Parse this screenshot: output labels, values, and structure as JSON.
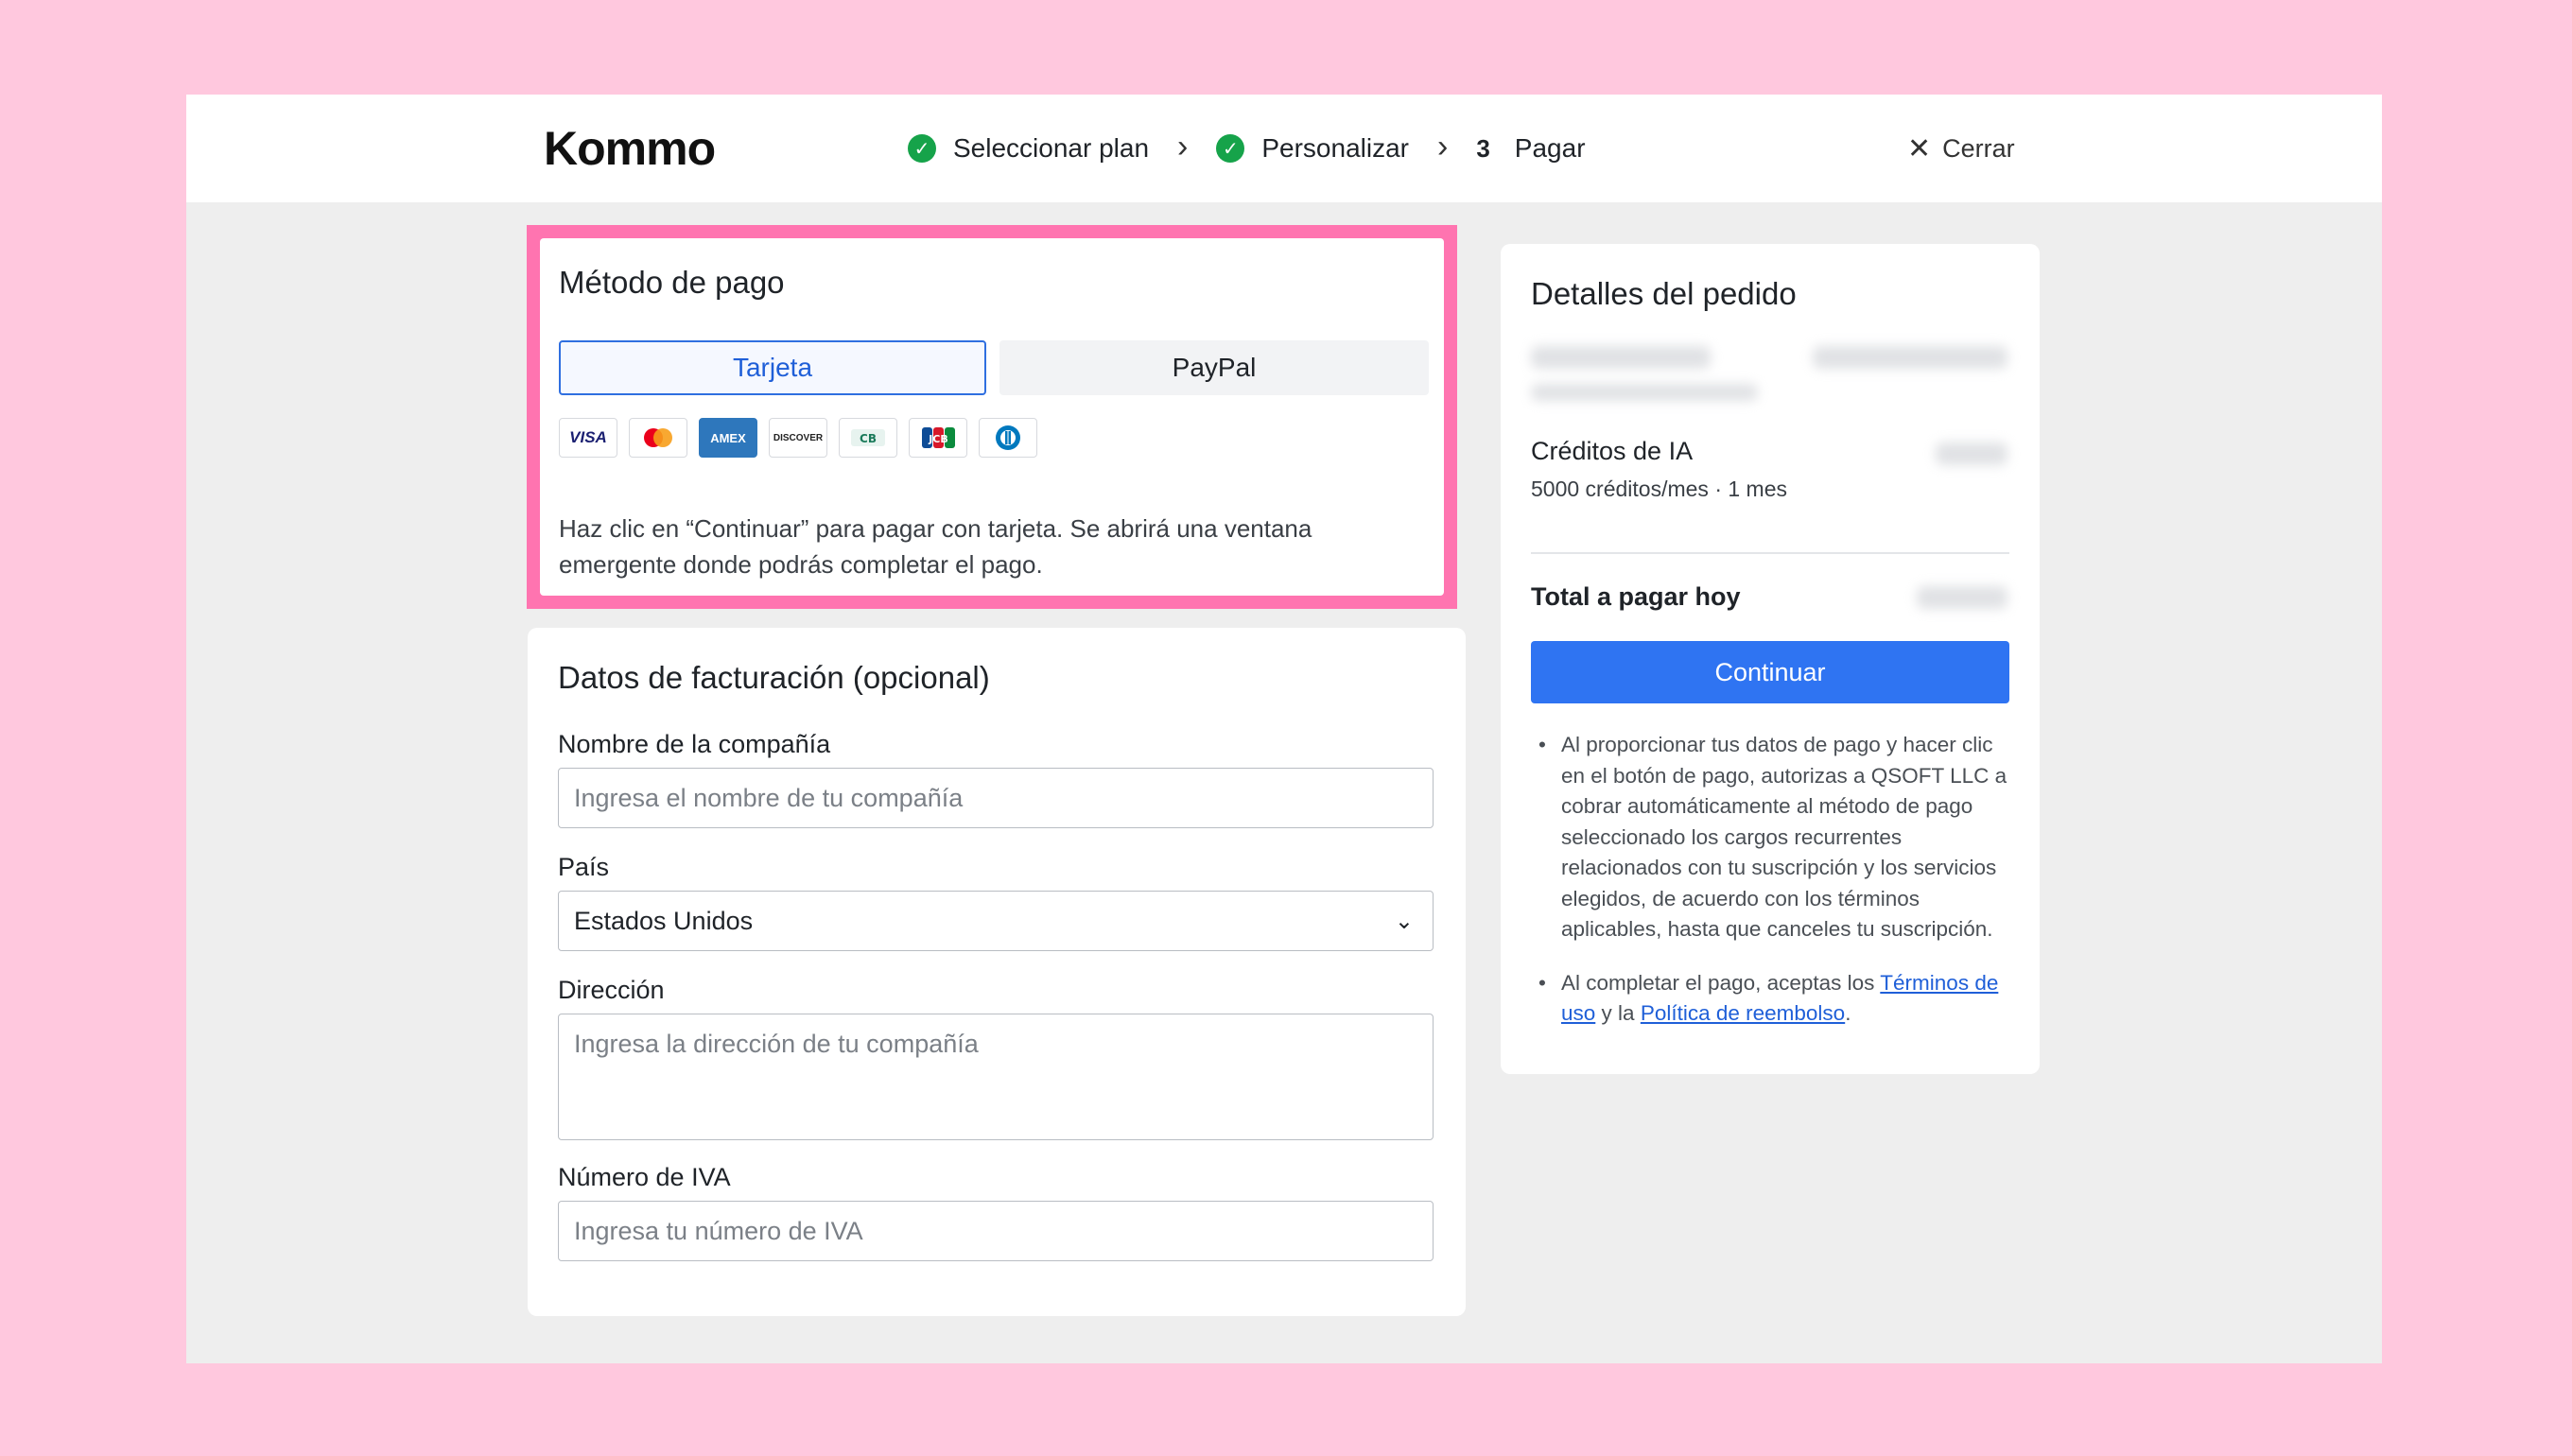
{
  "header": {
    "logo": "Kommo",
    "steps": [
      {
        "label": "Seleccionar plan",
        "status": "done"
      },
      {
        "label": "Personalizar",
        "status": "done"
      },
      {
        "label": "Pagar",
        "number": "3",
        "status": "current"
      }
    ],
    "close_label": "Cerrar"
  },
  "payment": {
    "title": "Método de pago",
    "tabs": [
      {
        "label": "Tarjeta",
        "selected": true
      },
      {
        "label": "PayPal",
        "selected": false
      }
    ],
    "card_brands": [
      "VISA",
      "mastercard",
      "AMEX",
      "DISCOVER",
      "CB",
      "JCB",
      "Diners Club"
    ],
    "description": "Haz clic en “Continuar” para pagar con tarjeta. Se abrirá una ventana emergente donde podrás completar el pago."
  },
  "billing": {
    "title": "Datos de facturación (opcional)",
    "company_label": "Nombre de la compañía",
    "company_placeholder": "Ingresa el nombre de tu compañía",
    "country_label": "País",
    "country_value": "Estados Unidos",
    "address_label": "Dirección",
    "address_placeholder": "Ingresa la dirección de tu compañía",
    "vat_label": "Número de IVA",
    "vat_placeholder": "Ingresa tu número de IVA"
  },
  "order": {
    "title": "Detalles del pedido",
    "ai_credits_title": "Créditos de IA",
    "ai_credits_sub": "5000 créditos/mes · 1 mes",
    "total_label": "Total a pagar hoy",
    "continue_label": "Continuar",
    "legal1": "Al proporcionar tus datos de pago y hacer clic en el botón de pago, autorizas a QSOFT LLC a cobrar automáticamente al método de pago seleccionado los cargos recurrentes relacionados con tu suscripción y los servicios elegidos, de acuerdo con los términos aplicables, hasta que canceles tu suscripción.",
    "legal2_prefix": "Al completar el pago, aceptas los",
    "terms_link": "Términos de uso",
    "legal2_middle": "y la",
    "refund_link": "Política de reembolso",
    "legal2_suffix": "."
  },
  "colors": {
    "background": "#ffc8de",
    "highlight": "#ff74b0",
    "primary": "#2f74f2",
    "success": "#16a34a"
  }
}
